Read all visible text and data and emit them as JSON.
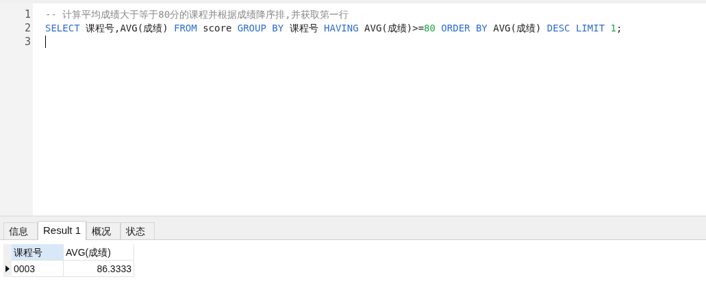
{
  "editor": {
    "lines": [
      {
        "number": "1",
        "tokens": [
          {
            "kind": "comment",
            "text": "-- 计算平均成绩大于等于80分的课程并根据成绩降序排,并获取第一行"
          }
        ]
      },
      {
        "number": "2",
        "tokens": [
          {
            "kind": "keyword",
            "text": "SELECT"
          },
          {
            "kind": "plain",
            "text": " 课程号,AVG(成绩) "
          },
          {
            "kind": "keyword",
            "text": "FROM"
          },
          {
            "kind": "plain",
            "text": " score "
          },
          {
            "kind": "keyword",
            "text": "GROUP BY"
          },
          {
            "kind": "plain",
            "text": " 课程号 "
          },
          {
            "kind": "keyword",
            "text": "HAVING"
          },
          {
            "kind": "plain",
            "text": " AVG(成绩)>="
          },
          {
            "kind": "number",
            "text": "80"
          },
          {
            "kind": "keyword",
            "text": " ORDER BY"
          },
          {
            "kind": "plain",
            "text": " AVG(成绩) "
          },
          {
            "kind": "keyword",
            "text": "DESC LIMIT "
          },
          {
            "kind": "number",
            "text": "1"
          },
          {
            "kind": "plain",
            "text": ";"
          }
        ]
      },
      {
        "number": "3",
        "cursor": true
      }
    ]
  },
  "result_tabs": [
    {
      "label": "信息",
      "selected": false
    },
    {
      "label": "Result 1",
      "selected": true
    },
    {
      "label": "概况",
      "selected": false
    },
    {
      "label": "状态",
      "selected": false
    }
  ],
  "grid": {
    "columns": [
      {
        "label": "课程号",
        "selected": true,
        "kind": "text"
      },
      {
        "label": "AVG(成绩)",
        "selected": false,
        "kind": "number"
      }
    ],
    "rows": [
      {
        "current": true,
        "cells": [
          "0003",
          "86.3333"
        ]
      }
    ]
  }
}
